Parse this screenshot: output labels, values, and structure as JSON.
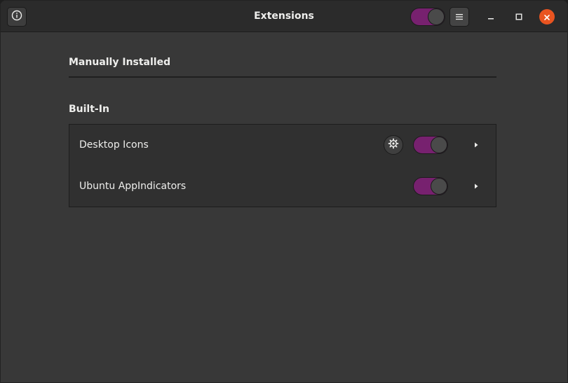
{
  "window": {
    "title": "Extensions",
    "extensions_enabled": true
  },
  "sections": {
    "manually_installed": "Manually Installed",
    "built_in": "Built-In"
  },
  "extensions": [
    {
      "name": "Desktop Icons",
      "enabled": true,
      "has_settings": true
    },
    {
      "name": "Ubuntu AppIndicators",
      "enabled": true,
      "has_settings": false
    }
  ],
  "icons": {
    "about": "info-icon",
    "menu": "hamburger-menu-icon",
    "minimize": "minimize-icon",
    "maximize": "maximize-icon",
    "close": "close-icon",
    "settings": "gear-icon",
    "expand": "chevron-right-icon"
  },
  "colors": {
    "switch_on": "#77216f",
    "close_button": "#e95420",
    "background": "#383838",
    "headerbar": "#2b2b2b"
  }
}
